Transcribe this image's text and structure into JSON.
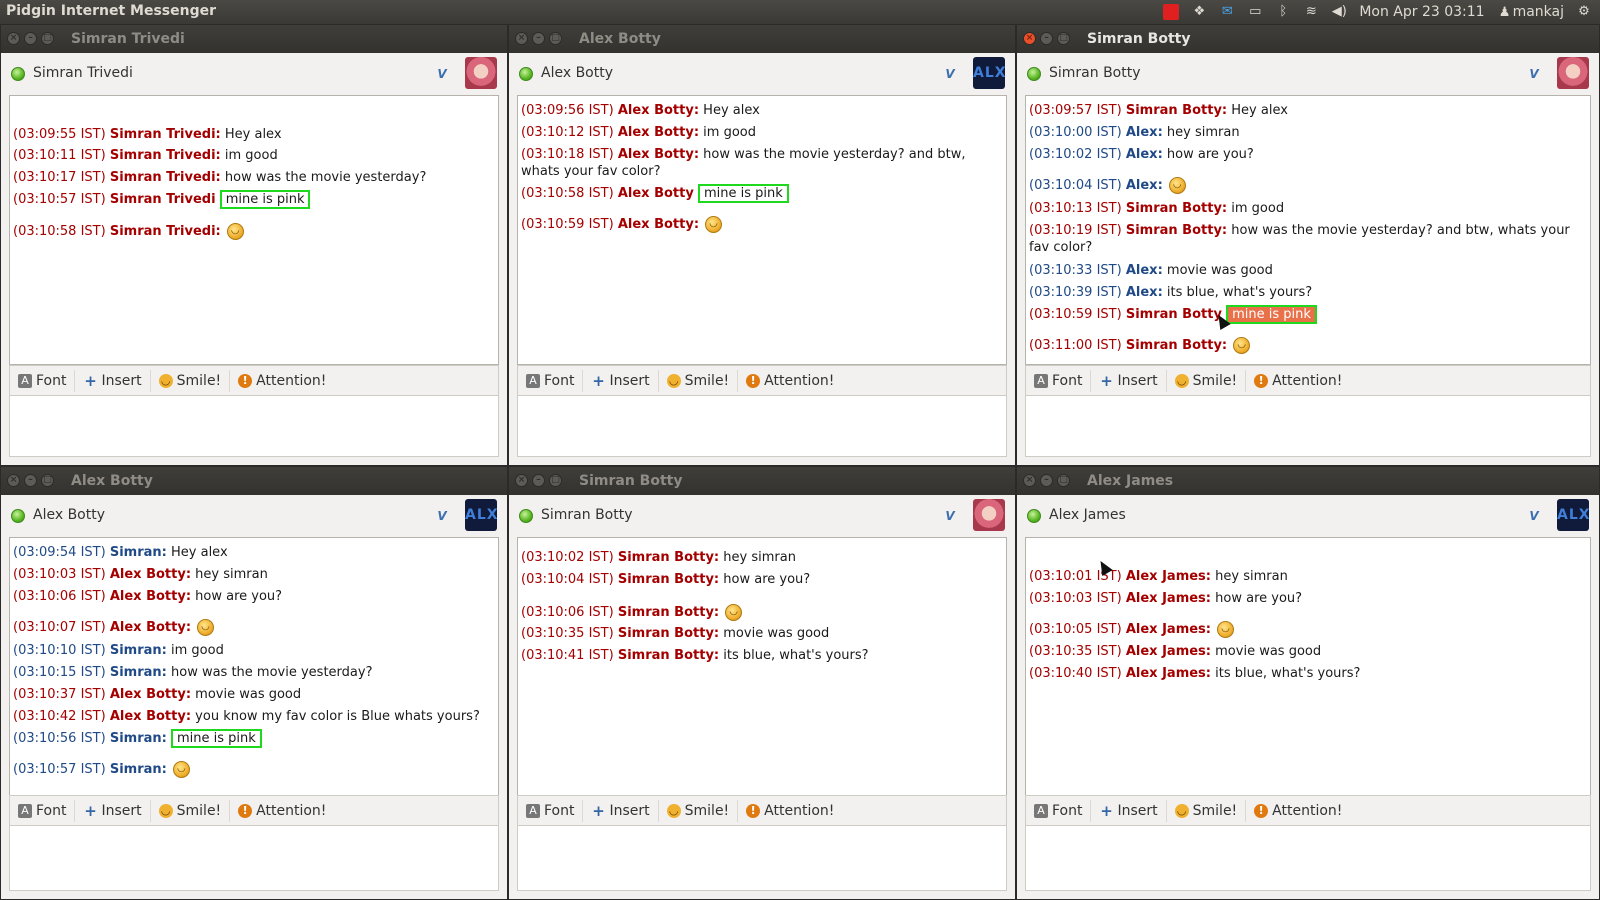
{
  "topbar": {
    "app_title": "Pidgin Internet Messenger",
    "datetime": "Mon Apr 23 03:11",
    "user": "mankaj",
    "icons": [
      "record-icon",
      "dropbox-icon",
      "mail-icon",
      "battery-icon",
      "bluetooth-icon",
      "wifi-icon",
      "volume-icon",
      "user-icon",
      "gear-icon"
    ]
  },
  "toolbar": {
    "font": "Font",
    "insert": "Insert",
    "smile": "Smile!",
    "attention": "Attention!"
  },
  "windows": [
    {
      "title": "Simran Trivedi",
      "contact": "Simran Trivedi",
      "avatar": "pink",
      "active": false,
      "messages": [
        {
          "ts": "(03:09:55 IST)",
          "name": "Simran Trivedi:",
          "text": "Hey alex",
          "color": "red"
        },
        {
          "ts": "(03:10:11 IST)",
          "name": "Simran Trivedi:",
          "text": "im good",
          "color": "red"
        },
        {
          "ts": "(03:10:17 IST)",
          "name": "Simran Trivedi:",
          "text": "how was the movie yesterday?",
          "color": "red"
        },
        {
          "ts": "(03:10:57 IST)",
          "name": "Simran Trivedi",
          "text": "mine is pink",
          "color": "red",
          "highlight": true
        },
        {
          "ts": "(03:10:58 IST)",
          "name": "Simran Trivedi:",
          "text": "",
          "color": "red",
          "smiley": true
        }
      ]
    },
    {
      "title": "Alex Botty",
      "contact": "Alex Botty",
      "avatar": "alx",
      "active": false,
      "messages": [
        {
          "ts": "(03:09:56 IST)",
          "name": "Alex Botty:",
          "text": "Hey alex",
          "color": "red"
        },
        {
          "ts": "(03:10:12 IST)",
          "name": "Alex Botty:",
          "text": "im good",
          "color": "red"
        },
        {
          "ts": "(03:10:18 IST)",
          "name": "Alex Botty:",
          "text": "how was the movie yesterday? and btw, whats your fav color?",
          "color": "red"
        },
        {
          "ts": "(03:10:58 IST)",
          "name": "Alex Botty",
          "text": "mine is pink",
          "color": "red",
          "highlight": true
        },
        {
          "ts": "(03:10:59 IST)",
          "name": "Alex Botty:",
          "text": "",
          "color": "red",
          "smiley": true
        }
      ]
    },
    {
      "title": "Simran Botty",
      "contact": "Simran Botty",
      "avatar": "pink",
      "active": true,
      "messages": [
        {
          "ts": "(03:09:57 IST)",
          "name": "Simran Botty:",
          "text": "Hey alex",
          "color": "red"
        },
        {
          "ts": "(03:10:00 IST)",
          "name": "Alex:",
          "text": "hey simran",
          "color": "blue"
        },
        {
          "ts": "(03:10:02 IST)",
          "name": "Alex:",
          "text": "how are you?",
          "color": "blue"
        },
        {
          "ts": "(03:10:04 IST)",
          "name": "Alex:",
          "text": "",
          "color": "blue",
          "smiley": true
        },
        {
          "ts": "(03:10:13 IST)",
          "name": "Simran Botty:",
          "text": "im good",
          "color": "red"
        },
        {
          "ts": "(03:10:19 IST)",
          "name": "Simran Botty:",
          "text": "how was the movie yesterday? and btw, whats your fav color?",
          "color": "red"
        },
        {
          "ts": "(03:10:33 IST)",
          "name": "Alex:",
          "text": "movie was good",
          "color": "blue"
        },
        {
          "ts": "(03:10:39 IST)",
          "name": "Alex:",
          "text": "its blue, what's yours?",
          "color": "blue"
        },
        {
          "ts": "(03:10:59 IST)",
          "name": "Simran Botty",
          "text": "mine is pink",
          "color": "red",
          "highlight": true,
          "selected": true
        },
        {
          "ts": "(03:11:00 IST)",
          "name": "Simran Botty:",
          "text": "",
          "color": "red",
          "smiley": true
        }
      ]
    },
    {
      "title": "Alex Botty",
      "contact": "Alex Botty",
      "avatar": "alx",
      "active": false,
      "messages": [
        {
          "ts": "(03:09:54 IST)",
          "name": "Simran:",
          "text": "Hey alex",
          "color": "blue"
        },
        {
          "ts": "(03:10:03 IST)",
          "name": "Alex Botty:",
          "text": "hey simran",
          "color": "red"
        },
        {
          "ts": "(03:10:06 IST)",
          "name": "Alex Botty:",
          "text": "how are you?",
          "color": "red"
        },
        {
          "ts": "(03:10:07 IST)",
          "name": "Alex Botty:",
          "text": "",
          "color": "red",
          "smiley": true
        },
        {
          "ts": "(03:10:10 IST)",
          "name": "Simran:",
          "text": "im good",
          "color": "blue"
        },
        {
          "ts": "(03:10:15 IST)",
          "name": "Simran:",
          "text": "how was the movie yesterday?",
          "color": "blue"
        },
        {
          "ts": "(03:10:37 IST)",
          "name": "Alex Botty:",
          "text": "movie was good",
          "color": "red"
        },
        {
          "ts": "(03:10:42 IST)",
          "name": "Alex Botty:",
          "text": "you know my fav color is Blue whats yours?",
          "color": "red"
        },
        {
          "ts": "(03:10:56 IST)",
          "name": "Simran:",
          "text": "mine is pink",
          "color": "blue",
          "highlight": true
        },
        {
          "ts": "(03:10:57 IST)",
          "name": "Simran:",
          "text": "",
          "color": "blue",
          "smiley": true
        }
      ]
    },
    {
      "title": "Simran Botty",
      "contact": "Simran Botty",
      "avatar": "pink",
      "active": false,
      "messages": [
        {
          "ts": "(03:10:02 IST)",
          "name": "Simran Botty:",
          "text": "hey simran",
          "color": "red"
        },
        {
          "ts": "(03:10:04 IST)",
          "name": "Simran Botty:",
          "text": "how are you?",
          "color": "red"
        },
        {
          "ts": "(03:10:06 IST)",
          "name": "Simran Botty:",
          "text": "",
          "color": "red",
          "smiley": true
        },
        {
          "ts": "(03:10:35 IST)",
          "name": "Simran Botty:",
          "text": "movie was good",
          "color": "red"
        },
        {
          "ts": "(03:10:41 IST)",
          "name": "Simran Botty:",
          "text": "its blue, what's yours?",
          "color": "red"
        }
      ]
    },
    {
      "title": "Alex James",
      "contact": "Alex James",
      "avatar": "alx",
      "active": false,
      "messages": [
        {
          "ts": "(03:10:01 IST)",
          "name": "Alex James:",
          "text": "hey simran",
          "color": "red"
        },
        {
          "ts": "(03:10:03 IST)",
          "name": "Alex James:",
          "text": "how are you?",
          "color": "red"
        },
        {
          "ts": "(03:10:05 IST)",
          "name": "Alex James:",
          "text": "",
          "color": "red",
          "smiley": true
        },
        {
          "ts": "(03:10:35 IST)",
          "name": "Alex James:",
          "text": "movie was good",
          "color": "red"
        },
        {
          "ts": "(03:10:40 IST)",
          "name": "Alex James:",
          "text": "its blue, what's yours?",
          "color": "red"
        }
      ]
    }
  ],
  "colors": {
    "highlight_border": "#1fd91f",
    "selection": "#e9714a",
    "own_name": "#a40000",
    "other_name": "#204a87"
  }
}
